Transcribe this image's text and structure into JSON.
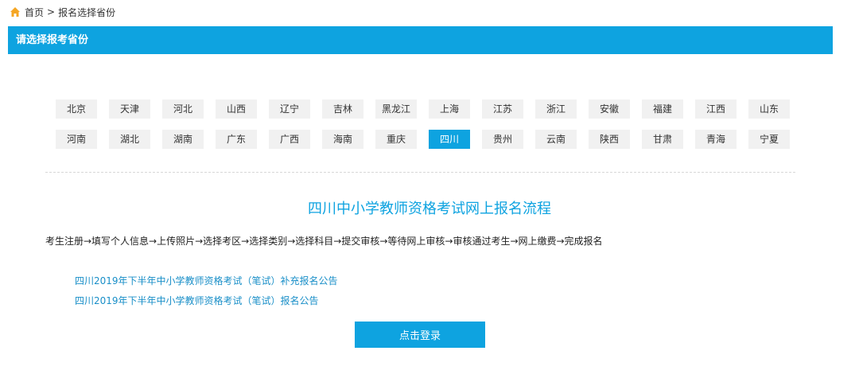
{
  "breadcrumb": {
    "home_label": "首页",
    "separator": ">",
    "current": "报名选择省份"
  },
  "title_bar": {
    "text": "请选择报考省份"
  },
  "provinces": {
    "row1": [
      "北京",
      "天津",
      "河北",
      "山西",
      "辽宁",
      "吉林",
      "黑龙江",
      "上海",
      "江苏",
      "浙江",
      "安徽",
      "福建",
      "江西",
      "山东"
    ],
    "row2": [
      "河南",
      "湖北",
      "湖南",
      "广东",
      "广西",
      "海南",
      "重庆",
      "四川",
      "贵州",
      "云南",
      "陕西",
      "甘肃",
      "青海",
      "宁夏"
    ],
    "selected": "四川"
  },
  "flow": {
    "title": "四川中小学教师资格考试网上报名流程",
    "steps": "考生注册→填写个人信息→上传照片→选择考区→选择类别→选择科目→提交审核→等待网上审核→审核通过考生→网上缴费→完成报名"
  },
  "notices": [
    "四川2019年下半年中小学教师资格考试（笔试）补充报名公告",
    "四川2019年下半年中小学教师资格考试（笔试）报名公告"
  ],
  "login_button": "点击登录",
  "colors": {
    "accent": "#0ea3e0",
    "home_icon": "#f5a623",
    "link": "#1a8fc8"
  },
  "icons": {
    "home": "home-icon"
  }
}
